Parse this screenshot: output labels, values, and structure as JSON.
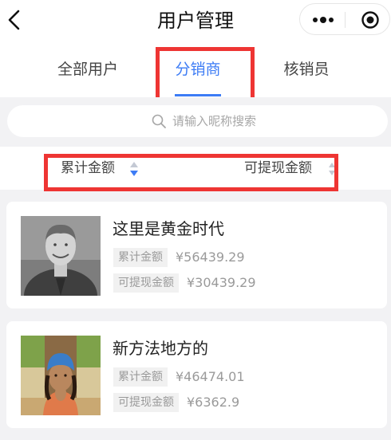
{
  "header": {
    "title": "用户管理"
  },
  "tabs": [
    {
      "label": "全部用户"
    },
    {
      "label": "分销商"
    },
    {
      "label": "核销员"
    }
  ],
  "search": {
    "placeholder": "请输入昵称搜索"
  },
  "sort": {
    "total_label": "累计金额",
    "withdrawable_label": "可提现金额"
  },
  "colors": {
    "accent": "#3d7cf5",
    "highlight_box": "#ee3533"
  },
  "users": [
    {
      "name": "这里是黄金时代",
      "total_tag": "累计金额",
      "total_amount": "¥56439.29",
      "withdraw_tag": "可提现金额",
      "withdraw_amount": "¥30439.29"
    },
    {
      "name": "新方法地方的",
      "total_tag": "累计金额",
      "total_amount": "¥46474.01",
      "withdraw_tag": "可提现金额",
      "withdraw_amount": "¥6362.9"
    }
  ]
}
